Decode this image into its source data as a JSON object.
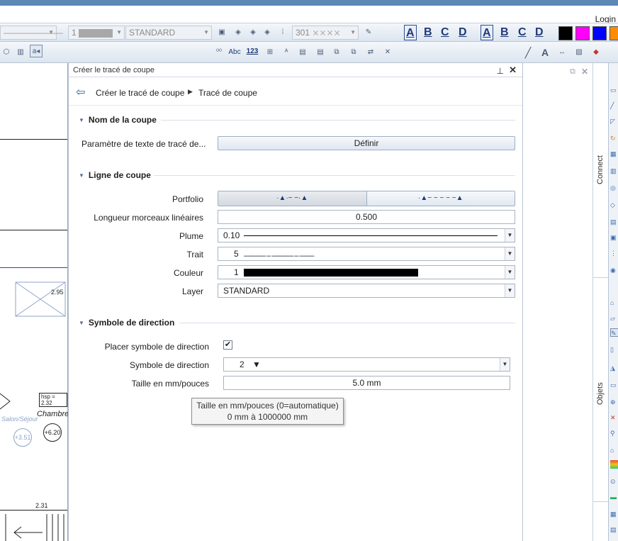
{
  "app": {
    "login_label": "Login"
  },
  "toolbar1": {
    "pen_value": "1",
    "layer_combo": "STANDARD",
    "line_value": "301",
    "text_styles": [
      "A",
      "B",
      "C",
      "D"
    ],
    "text_styles2": [
      "A",
      "B",
      "C",
      "D"
    ],
    "colors": [
      "#000000",
      "#ff00ff",
      "#0000ff",
      "#ff8c00"
    ]
  },
  "toolbar2": {
    "abc_label": "Abc",
    "num_label": "123"
  },
  "drawing": {
    "dim1": "2.95",
    "dim2": "hsp = 2.32",
    "room": "Chambre",
    "level1": "+6.20",
    "level2": "+3.51",
    "dim3": "2.31",
    "room2": "Salon/Séjour"
  },
  "panel": {
    "title": "Créer le tracé de coupe",
    "breadcrumb": [
      "Créer le tracé de coupe",
      "Tracé de coupe"
    ],
    "sections": {
      "name": {
        "title": "Nom de la coupe",
        "text_param_label": "Paramètre de texte de tracé de...",
        "define_button": "Définir"
      },
      "line": {
        "title": "Ligne de coupe",
        "portfolio_label": "Portfolio",
        "length_label": "Longueur morceaux linéaires",
        "length_value": "0.500",
        "pen_label": "Plume",
        "pen_value": "0.10",
        "line_label": "Trait",
        "line_value": "5",
        "color_label": "Couleur",
        "color_value": "1",
        "layer_label": "Layer",
        "layer_value": "STANDARD"
      },
      "direction": {
        "title": "Symbole de direction",
        "place_label": "Placer symbole de direction",
        "place_checked": true,
        "symbol_label": "Symbole de direction",
        "symbol_value": "2",
        "size_label": "Taille en mm/pouces",
        "size_value": "5.0 mm"
      }
    },
    "tooltip": {
      "line1": "Taille en mm/pouces (0=automatique)",
      "line2": "0 mm à 1000000 mm"
    }
  },
  "side": {
    "tab_connect": "Connect",
    "tab_objects": "Objets"
  }
}
